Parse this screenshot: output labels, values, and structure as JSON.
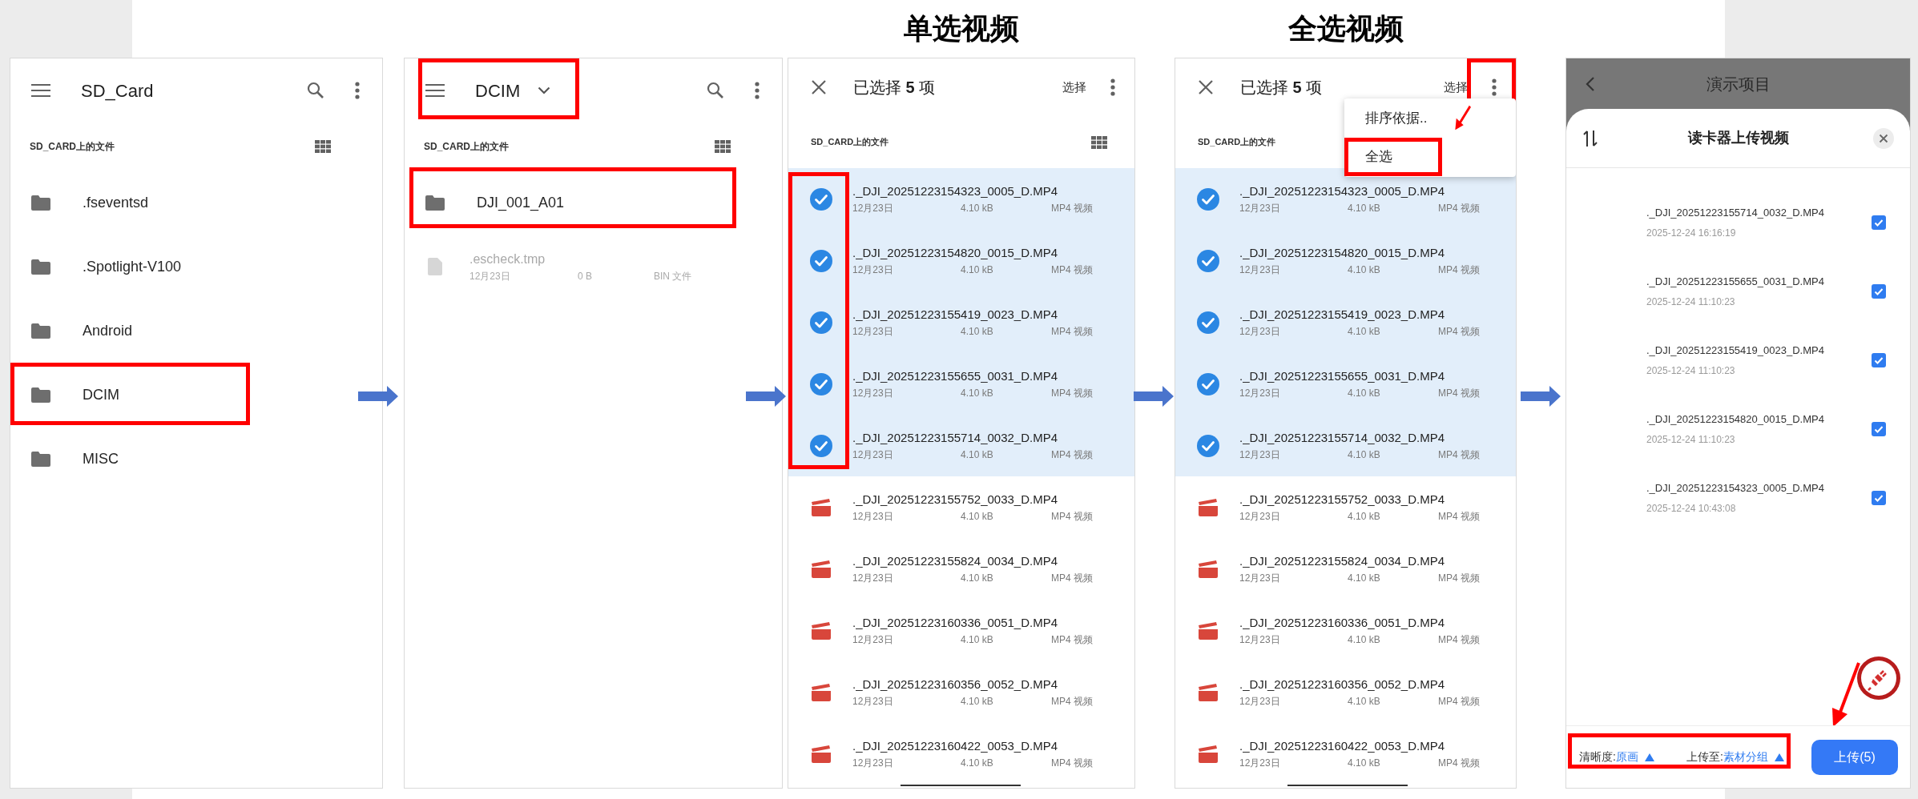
{
  "steps": [
    {
      "kind": "folders",
      "toolbar": {
        "title": "SD_Card",
        "dropdown": false,
        "highlighted": false
      },
      "section": "SD_CARD上的文件",
      "items": [
        {
          "kind": "folder",
          "name": ".fseventsd",
          "highlighted": false
        },
        {
          "kind": "folder",
          "name": ".Spotlight-V100",
          "highlighted": false
        },
        {
          "kind": "folder",
          "name": "Android",
          "highlighted": false
        },
        {
          "kind": "folder",
          "name": "DCIM",
          "highlighted": true
        },
        {
          "kind": "folder",
          "name": "MISC",
          "highlighted": false
        }
      ]
    },
    {
      "kind": "folders",
      "toolbar": {
        "title": "DCIM",
        "dropdown": true,
        "highlighted": true
      },
      "section": "SD_CARD上的文件",
      "items": [
        {
          "kind": "folder",
          "name": "DJI_001_A01",
          "highlighted": true
        },
        {
          "kind": "file",
          "name": ".escheck.tmp",
          "date": "12月23日",
          "size": "0 B",
          "file_type": "BIN 文件",
          "disabled": true,
          "highlighted": false
        }
      ]
    },
    {
      "kind": "selection",
      "caption": "单选视频",
      "title": "已选择 **5** 项",
      "action": "选择",
      "section": "SD_CARD上的文件",
      "checks_highlighted": true,
      "menu_button_highlighted": false,
      "items": [
        {
          "name": "._DJI_20251223154323_0005_D.MP4",
          "date": "12月23日",
          "size": "4.10 kB",
          "file_type": "MP4 视频",
          "selected": true
        },
        {
          "name": "._DJI_20251223154820_0015_D.MP4",
          "date": "12月23日",
          "size": "4.10 kB",
          "file_type": "MP4 视频",
          "selected": true
        },
        {
          "name": "._DJI_20251223155419_0023_D.MP4",
          "date": "12月23日",
          "size": "4.10 kB",
          "file_type": "MP4 视频",
          "selected": true
        },
        {
          "name": "._DJI_20251223155655_0031_D.MP4",
          "date": "12月23日",
          "size": "4.10 kB",
          "file_type": "MP4 视频",
          "selected": true
        },
        {
          "name": "._DJI_20251223155714_0032_D.MP4",
          "date": "12月23日",
          "size": "4.10 kB",
          "file_type": "MP4 视频",
          "selected": true
        },
        {
          "name": "._DJI_20251223155752_0033_D.MP4",
          "date": "12月23日",
          "size": "4.10 kB",
          "file_type": "MP4 视频",
          "selected": false
        },
        {
          "name": "._DJI_20251223155824_0034_D.MP4",
          "date": "12月23日",
          "size": "4.10 kB",
          "file_type": "MP4 视频",
          "selected": false
        },
        {
          "name": "._DJI_20251223160336_0051_D.MP4",
          "date": "12月23日",
          "size": "4.10 kB",
          "file_type": "MP4 视频",
          "selected": false
        },
        {
          "name": "._DJI_20251223160356_0052_D.MP4",
          "date": "12月23日",
          "size": "4.10 kB",
          "file_type": "MP4 视频",
          "selected": false
        },
        {
          "name": "._DJI_20251223160422_0053_D.MP4",
          "date": "12月23日",
          "size": "4.10 kB",
          "file_type": "MP4 视频",
          "selected": false
        }
      ]
    },
    {
      "kind": "selection",
      "caption": "全选视频",
      "title": "已选择 **5** 项",
      "action": "选择",
      "section": "SD_CARD上的文件",
      "checks_highlighted": false,
      "menu_button_highlighted": true,
      "menu": [
        {
          "label": "排序依据..",
          "highlighted": false
        },
        {
          "label": "全选",
          "highlighted": true
        }
      ],
      "items": [
        {
          "name": "._DJI_20251223154323_0005_D.MP4",
          "date": "12月23日",
          "size": "4.10 kB",
          "file_type": "MP4 视频",
          "selected": true
        },
        {
          "name": "._DJI_20251223154820_0015_D.MP4",
          "date": "12月23日",
          "size": "4.10 kB",
          "file_type": "MP4 视频",
          "selected": true
        },
        {
          "name": "._DJI_20251223155419_0023_D.MP4",
          "date": "12月23日",
          "size": "4.10 kB",
          "file_type": "MP4 视频",
          "selected": true
        },
        {
          "name": "._DJI_20251223155655_0031_D.MP4",
          "date": "12月23日",
          "size": "4.10 kB",
          "file_type": "MP4 视频",
          "selected": true
        },
        {
          "name": "._DJI_20251223155714_0032_D.MP4",
          "date": "12月23日",
          "size": "4.10 kB",
          "file_type": "MP4 视频",
          "selected": true
        },
        {
          "name": "._DJI_20251223155752_0033_D.MP4",
          "date": "12月23日",
          "size": "4.10 kB",
          "file_type": "MP4 视频",
          "selected": false
        },
        {
          "name": "._DJI_20251223155824_0034_D.MP4",
          "date": "12月23日",
          "size": "4.10 kB",
          "file_type": "MP4 视频",
          "selected": false
        },
        {
          "name": "._DJI_20251223160336_0051_D.MP4",
          "date": "12月23日",
          "size": "4.10 kB",
          "file_type": "MP4 视频",
          "selected": false
        },
        {
          "name": "._DJI_20251223160356_0052_D.MP4",
          "date": "12月23日",
          "size": "4.10 kB",
          "file_type": "MP4 视频",
          "selected": false
        },
        {
          "name": "._DJI_20251223160422_0053_D.MP4",
          "date": "12月23日",
          "size": "4.10 kB",
          "file_type": "MP4 视频",
          "selected": false
        }
      ]
    },
    {
      "kind": "upload",
      "app_title": "演示项目",
      "sheet_title": "读卡器上传视频",
      "items": [
        {
          "name": "._DJI_20251223155714_0032_D.MP4",
          "time": "2025-12-24 16:16:19",
          "checked": true
        },
        {
          "name": "._DJI_20251223155655_0031_D.MP4",
          "time": "2025-12-24 11:10:23",
          "checked": true
        },
        {
          "name": "._DJI_20251223155419_0023_D.MP4",
          "time": "2025-12-24 11:10:23",
          "checked": true
        },
        {
          "name": "._DJI_20251223154820_0015_D.MP4",
          "time": "2025-12-24 11:10:23",
          "checked": true
        },
        {
          "name": "._DJI_20251223154323_0005_D.MP4",
          "time": "2025-12-24 10:43:08",
          "checked": true
        }
      ],
      "quality_label": "清晰度:",
      "quality": "原画",
      "target_label": "上传至:",
      "target": "素材分组",
      "footer_highlighted": true,
      "upload_button": "上传(5)"
    }
  ]
}
